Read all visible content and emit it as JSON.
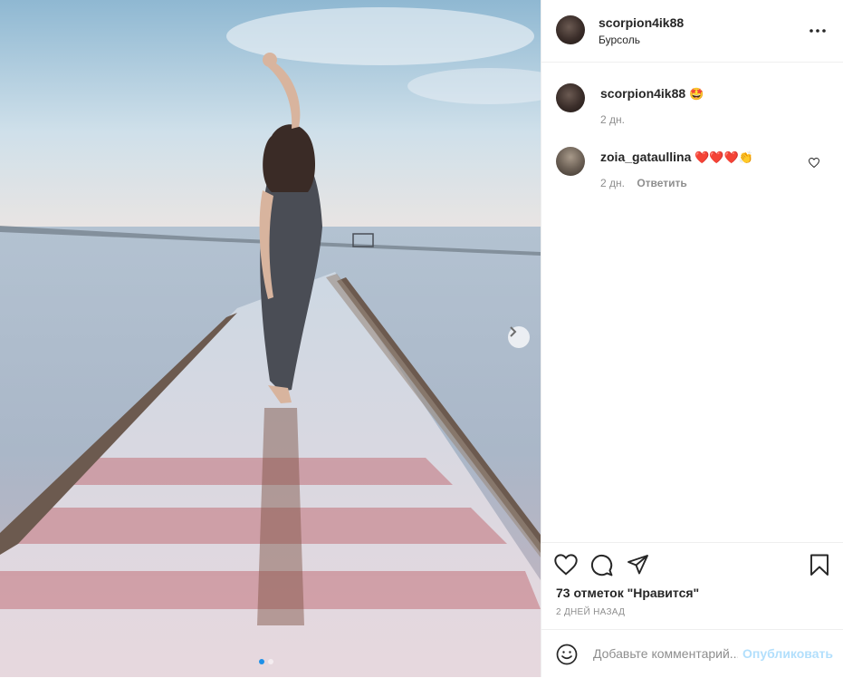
{
  "post": {
    "username": "scorpion4ik88",
    "location": "Бурсоль",
    "more_icon": "more-horizontal-icon"
  },
  "comments": [
    {
      "username": "scorpion4ik88",
      "text": "🤩",
      "time": "2 дн.",
      "reply": ""
    },
    {
      "username": "zoia_gataullina",
      "text": "❤️❤️❤️👏",
      "time": "2 дн.",
      "reply": "Ответить"
    }
  ],
  "actions": {
    "like_icon": "heart-icon",
    "comment_icon": "comment-icon",
    "share_icon": "paper-plane-icon",
    "save_icon": "bookmark-icon"
  },
  "likes_text": "73 отметок \"Нравится\"",
  "date_text": "2 ДНЕЙ НАЗАД",
  "add_comment": {
    "placeholder": "Добавьте комментарий...",
    "publish_label": "Опубликовать"
  },
  "carousel": {
    "count": 2,
    "active_index": 0
  },
  "colors": {
    "accent": "#0095f6",
    "publish_disabled": "#b2dffc",
    "muted": "#8e8e8e"
  }
}
